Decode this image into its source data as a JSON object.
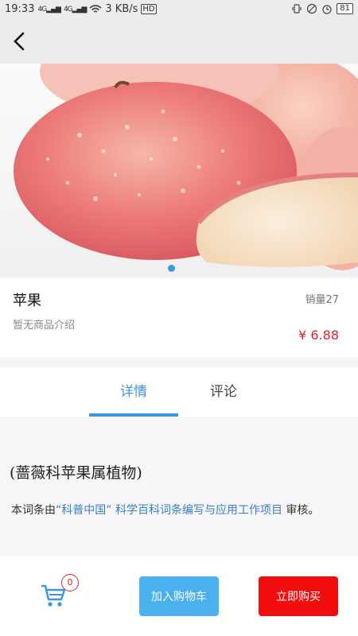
{
  "status_bar": {
    "time": "19:33",
    "net_left": "4G",
    "net_right": "4G",
    "speed": "3 KB/s",
    "hd": "HD",
    "battery": "81"
  },
  "product": {
    "name": "苹果",
    "description": "暂无商品介绍",
    "sales": "销量27",
    "price": "¥ 6.88"
  },
  "tabs": [
    {
      "label": "详情",
      "active": true
    },
    {
      "label": "评论",
      "active": false
    }
  ],
  "detail": {
    "heading": "(蔷薇科苹果属植物)",
    "para_prefix": "本词条由",
    "link1": "“科普中国”",
    "link2": "科学百科词条编写与应用工作项目",
    "para_suffix": "审核。"
  },
  "bottom": {
    "cart_count": "0",
    "add_to_cart": "加入购物车",
    "buy_now": "立即购买"
  },
  "colors": {
    "accent": "#3a97e3",
    "price": "#e4242d",
    "add_cart_button": "#4bb0ee",
    "buy_button": "#f20e0e"
  },
  "carousel": {
    "current": 1,
    "total": 1
  }
}
